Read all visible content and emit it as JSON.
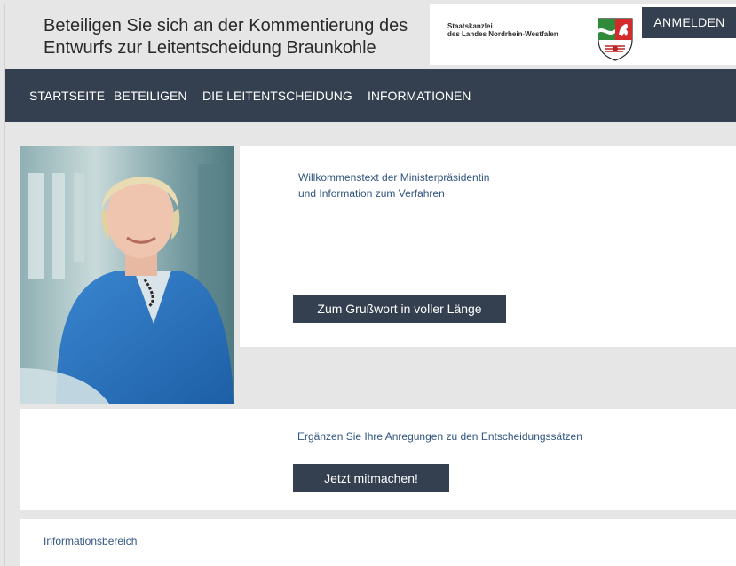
{
  "header": {
    "title_line1": "Beteiligen Sie sich an der Kommentierung des",
    "title_line2": "Entwurfs zur Leitentscheidung Braunkohle",
    "brand_line1": "Staatskanzlei",
    "brand_line2": "des Landes Nordrhein-Westfalen",
    "crest_icon": "nrw-coat-of-arms-icon",
    "login_label": "ANMELDEN"
  },
  "nav": {
    "items": [
      {
        "label": "STARTSEITE"
      },
      {
        "label": "BETEILIGEN"
      },
      {
        "label": "DIE LEITENTSCHEIDUNG"
      },
      {
        "label": "INFORMATIONEN"
      }
    ]
  },
  "welcome": {
    "text_line1": "Willkommenstext der Ministerpräsidentin",
    "text_line2": "und Information zum Verfahren",
    "button_label": "Zum Grußwort in voller Länge"
  },
  "participate": {
    "text": "Ergänzen Sie Ihre Anregungen zu den Entscheidungssätzen",
    "button_label": "Jetzt mitmachen!"
  },
  "info": {
    "text": "Informationsbereich"
  },
  "colors": {
    "nav_bg": "#343f4f",
    "link_blue": "#2f5480",
    "page_bg": "#e6e6e6"
  }
}
